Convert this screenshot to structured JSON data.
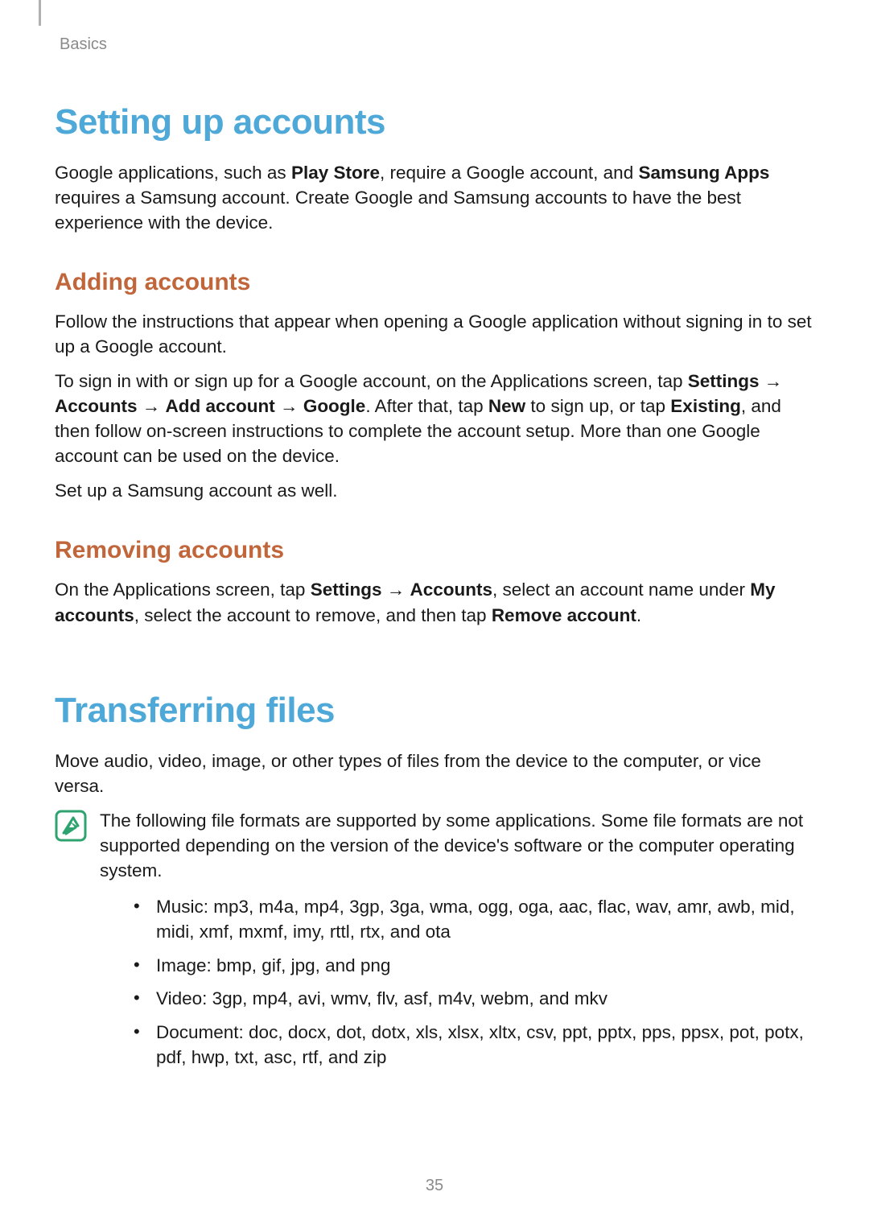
{
  "header": {
    "section_label": "Basics"
  },
  "section1": {
    "title": "Setting up accounts",
    "intro": {
      "t1": "Google applications, such as ",
      "b1": "Play Store",
      "t2": ", require a Google account, and ",
      "b2": "Samsung Apps",
      "t3": " requires a Samsung account. Create Google and Samsung accounts to have the best experience with the device."
    },
    "sub1": {
      "title": "Adding accounts",
      "p1": "Follow the instructions that appear when opening a Google application without signing in to set up a Google account.",
      "p2": {
        "t1": "To sign in with or sign up for a Google account, on the Applications screen, tap ",
        "b1": "Settings",
        "arr1": " → ",
        "b2": "Accounts",
        "arr2": " → ",
        "b3": "Add account",
        "arr3": " → ",
        "b4": "Google",
        "t2": ". After that, tap ",
        "b5": "New",
        "t3": " to sign up, or tap ",
        "b6": "Existing",
        "t4": ", and then follow on-screen instructions to complete the account setup. More than one Google account can be used on the device."
      },
      "p3": "Set up a Samsung account as well."
    },
    "sub2": {
      "title": "Removing accounts",
      "p1": {
        "t1": "On the Applications screen, tap ",
        "b1": "Settings",
        "arr1": " → ",
        "b2": "Accounts",
        "t2": ", select an account name under ",
        "b3": "My accounts",
        "t3": ", select the account to remove, and then tap ",
        "b4": "Remove account",
        "t4": "."
      }
    }
  },
  "section2": {
    "title": "Transferring files",
    "intro": "Move audio, video, image, or other types of files from the device to the computer, or vice versa.",
    "note": "The following file formats are supported by some applications. Some file formats are not supported depending on the version of the device's software or the computer operating system.",
    "formats": {
      "music": "Music: mp3, m4a, mp4, 3gp, 3ga, wma, ogg, oga, aac, flac, wav, amr, awb, mid, midi, xmf, mxmf, imy, rttl, rtx, and ota",
      "image": "Image: bmp, gif, jpg, and png",
      "video": "Video: 3gp, mp4, avi, wmv, flv, asf, m4v, webm, and mkv",
      "document": "Document: doc, docx, dot, dotx, xls, xlsx, xltx, csv, ppt, pptx, pps, ppsx, pot, potx, pdf, hwp, txt, asc, rtf, and zip"
    }
  },
  "page_number": "35",
  "colors": {
    "h1": "#4ea8d8",
    "h2": "#c1663a",
    "note_icon": "#2fa36f"
  }
}
